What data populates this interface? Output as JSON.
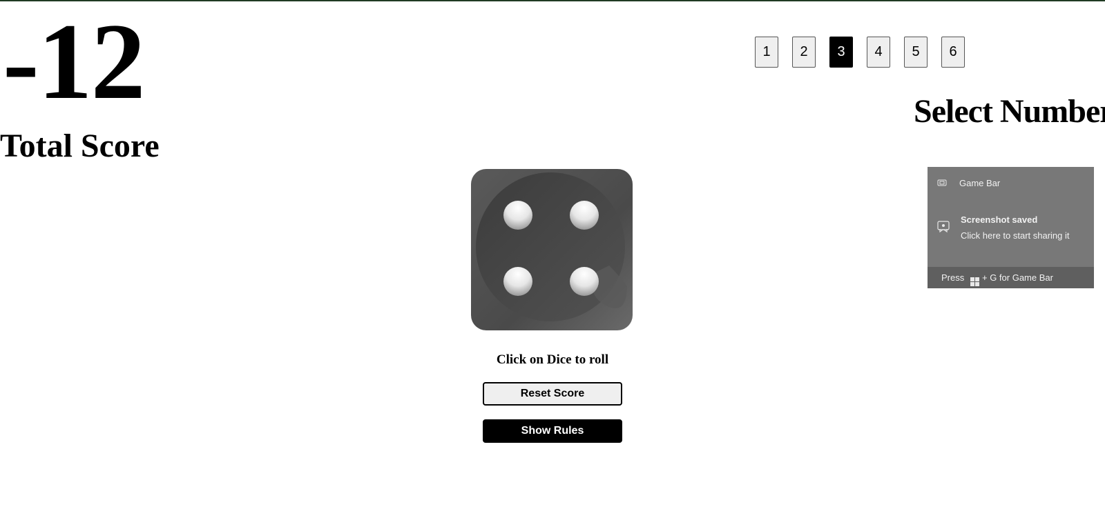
{
  "score": {
    "value": "-12",
    "label": "Total Score"
  },
  "selector": {
    "label": "Select Number",
    "numbers": [
      "1",
      "2",
      "3",
      "4",
      "5",
      "6"
    ],
    "selected": "3"
  },
  "dice": {
    "face": 4,
    "icon": "dice-four-icon",
    "hint": "Click on Dice to roll"
  },
  "buttons": {
    "reset": "Reset Score",
    "rules": "Show Rules"
  },
  "toast": {
    "app_name": "Game Bar",
    "title": "Screenshot saved",
    "subtitle": "Click here to start sharing it",
    "footer_prefix": "Press",
    "footer_suffix": "+ G for Game Bar"
  },
  "colors": {
    "selected_bg": "#000000",
    "toast_bg": "#787878",
    "toast_footer_bg": "#5f5f5f",
    "dice_body": "#4a4a4a"
  }
}
